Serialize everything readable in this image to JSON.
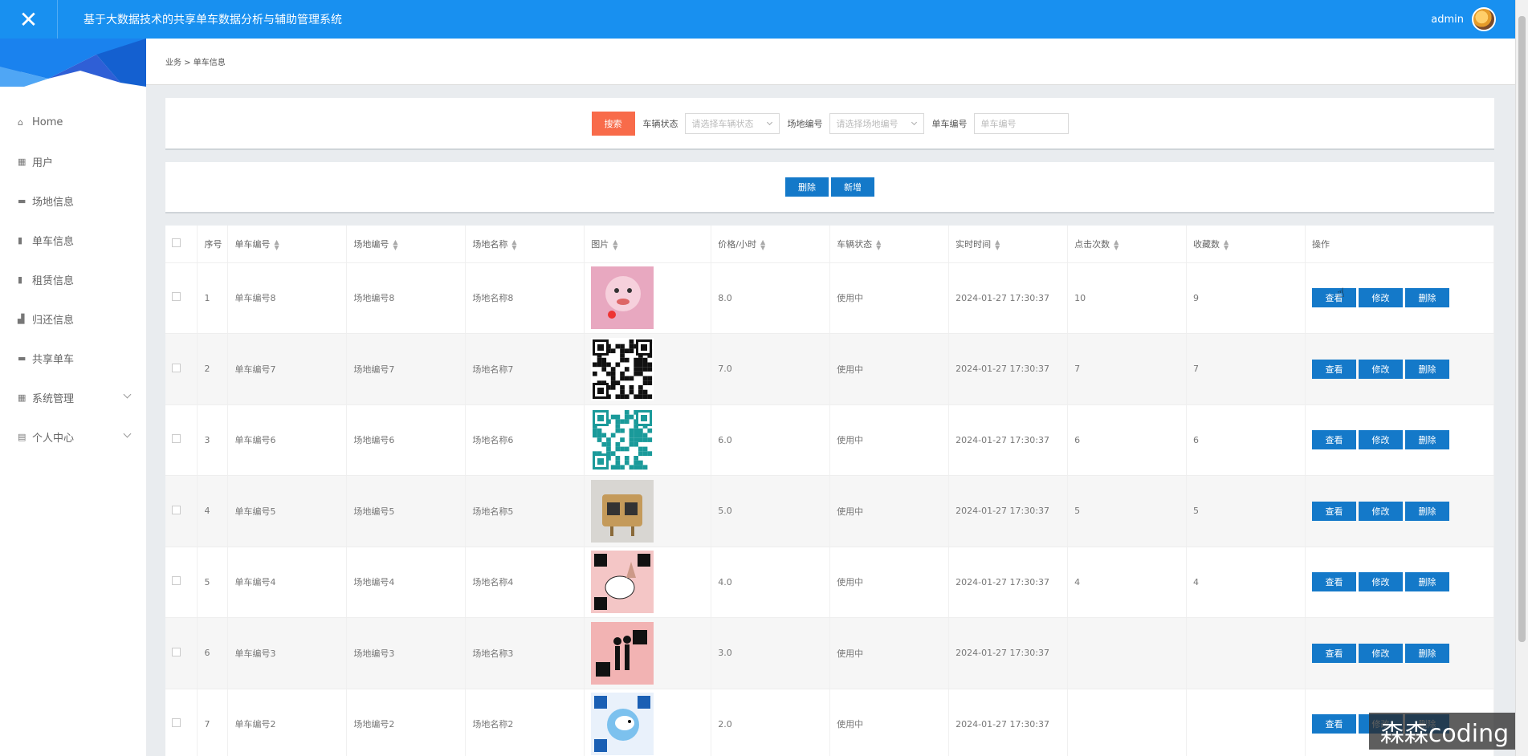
{
  "header": {
    "title": "基于大数据技术的共享单车数据分析与辅助管理系统",
    "username": "admin"
  },
  "sidebar": {
    "items": [
      {
        "label": "Home",
        "icon": "home-icon",
        "glyph": "⌂"
      },
      {
        "label": "用户",
        "icon": "grid-icon",
        "glyph": "▦"
      },
      {
        "label": "场地信息",
        "icon": "briefcase-icon",
        "glyph": "▬"
      },
      {
        "label": "单车信息",
        "icon": "clipboard-icon",
        "glyph": "▮"
      },
      {
        "label": "租赁信息",
        "icon": "clipboard-icon",
        "glyph": "▮"
      },
      {
        "label": "归还信息",
        "icon": "thumb-icon",
        "glyph": "▟"
      },
      {
        "label": "共享单车",
        "icon": "mug-icon",
        "glyph": "▬"
      },
      {
        "label": "系统管理",
        "icon": "grid-icon",
        "glyph": "▦"
      },
      {
        "label": "个人中心",
        "icon": "calendar-icon",
        "glyph": "▤"
      }
    ]
  },
  "breadcrumb": "业务 > 单车信息",
  "search": {
    "button": "搜索",
    "status_label": "车辆状态",
    "status_placeholder": "请选择车辆状态",
    "site_label": "场地编号",
    "site_placeholder": "请选择场地编号",
    "bike_label": "单车编号",
    "bike_placeholder": "单车编号"
  },
  "actions": {
    "delete": "删除",
    "add": "新增"
  },
  "table": {
    "headers": [
      "序号",
      "单车编号",
      "场地编号",
      "场地名称",
      "图片",
      "价格/小时",
      "车辆状态",
      "实时时间",
      "点击次数",
      "收藏数",
      "操作"
    ],
    "row_buttons": {
      "view": "查看",
      "edit": "修改",
      "delete": "删除"
    },
    "rows": [
      {
        "no": "1",
        "bike": "单车编号8",
        "site": "场地编号8",
        "name": "场地名称8",
        "price": "8.0",
        "status": "使用中",
        "time": "2024-01-27 17:30:37",
        "clicks": "10",
        "favs": "9",
        "img": "pink"
      },
      {
        "no": "2",
        "bike": "单车编号7",
        "site": "场地编号7",
        "name": "场地名称7",
        "price": "7.0",
        "status": "使用中",
        "time": "2024-01-27 17:30:37",
        "clicks": "7",
        "favs": "7",
        "img": "qr-black"
      },
      {
        "no": "3",
        "bike": "单车编号6",
        "site": "场地编号6",
        "name": "场地名称6",
        "price": "6.0",
        "status": "使用中",
        "time": "2024-01-27 17:30:37",
        "clicks": "6",
        "favs": "6",
        "img": "qr-teal"
      },
      {
        "no": "4",
        "bike": "单车编号5",
        "site": "场地编号5",
        "name": "场地名称5",
        "price": "5.0",
        "status": "使用中",
        "time": "2024-01-27 17:30:37",
        "clicks": "5",
        "favs": "5",
        "img": "sign"
      },
      {
        "no": "5",
        "bike": "单车编号4",
        "site": "场地编号4",
        "name": "场地名称4",
        "price": "4.0",
        "status": "使用中",
        "time": "2024-01-27 17:30:37",
        "clicks": "4",
        "favs": "4",
        "img": "cartoon"
      },
      {
        "no": "6",
        "bike": "单车编号3",
        "site": "场地编号3",
        "name": "场地名称3",
        "price": "3.0",
        "status": "使用中",
        "time": "2024-01-27 17:30:37",
        "clicks": "",
        "favs": "",
        "img": "couple"
      },
      {
        "no": "7",
        "bike": "单车编号2",
        "site": "场地编号2",
        "name": "场地名称2",
        "price": "2.0",
        "status": "使用中",
        "time": "2024-01-27 17:30:37",
        "clicks": "",
        "favs": "",
        "img": "snoopy"
      }
    ]
  },
  "watermark": "森森coding",
  "colors": {
    "topbar": "#1890f0",
    "primary_button": "#1479c9",
    "search_button": "#f86b4a"
  }
}
